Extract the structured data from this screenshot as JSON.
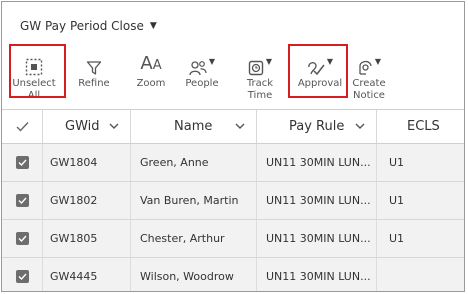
{
  "title": "GW Pay Period Close",
  "toolbar": {
    "unselect_all": "Unselect All",
    "refine": "Refine",
    "zoom": "Zoom",
    "people": "People",
    "track_time": "Track Time",
    "approval": "Approval",
    "create_notice": "Create\nNotice"
  },
  "columns": {
    "gwid": "GWid",
    "name": "Name",
    "pay_rule": "Pay Rule",
    "ecls": "ECLS"
  },
  "rows": [
    {
      "gwid": "GW1804",
      "name": "Green, Anne",
      "pay_rule": "UN11 30MIN LUN...",
      "ecls": "U1"
    },
    {
      "gwid": "GW1802",
      "name": "Van Buren, Martin",
      "pay_rule": "UN11 30MIN LUN...",
      "ecls": "U1"
    },
    {
      "gwid": "GW1805",
      "name": "Chester, Arthur",
      "pay_rule": "UN11 30MIN LUN...",
      "ecls": "U1"
    },
    {
      "gwid": "GW4445",
      "name": "Wilson, Woodrow",
      "pay_rule": "UN11 30MIN LUN...",
      "ecls": ""
    }
  ],
  "colors": {
    "highlight": "#d61e1e",
    "row_bg": "#f2f2f2",
    "checkbox": "#6d6d6d"
  }
}
